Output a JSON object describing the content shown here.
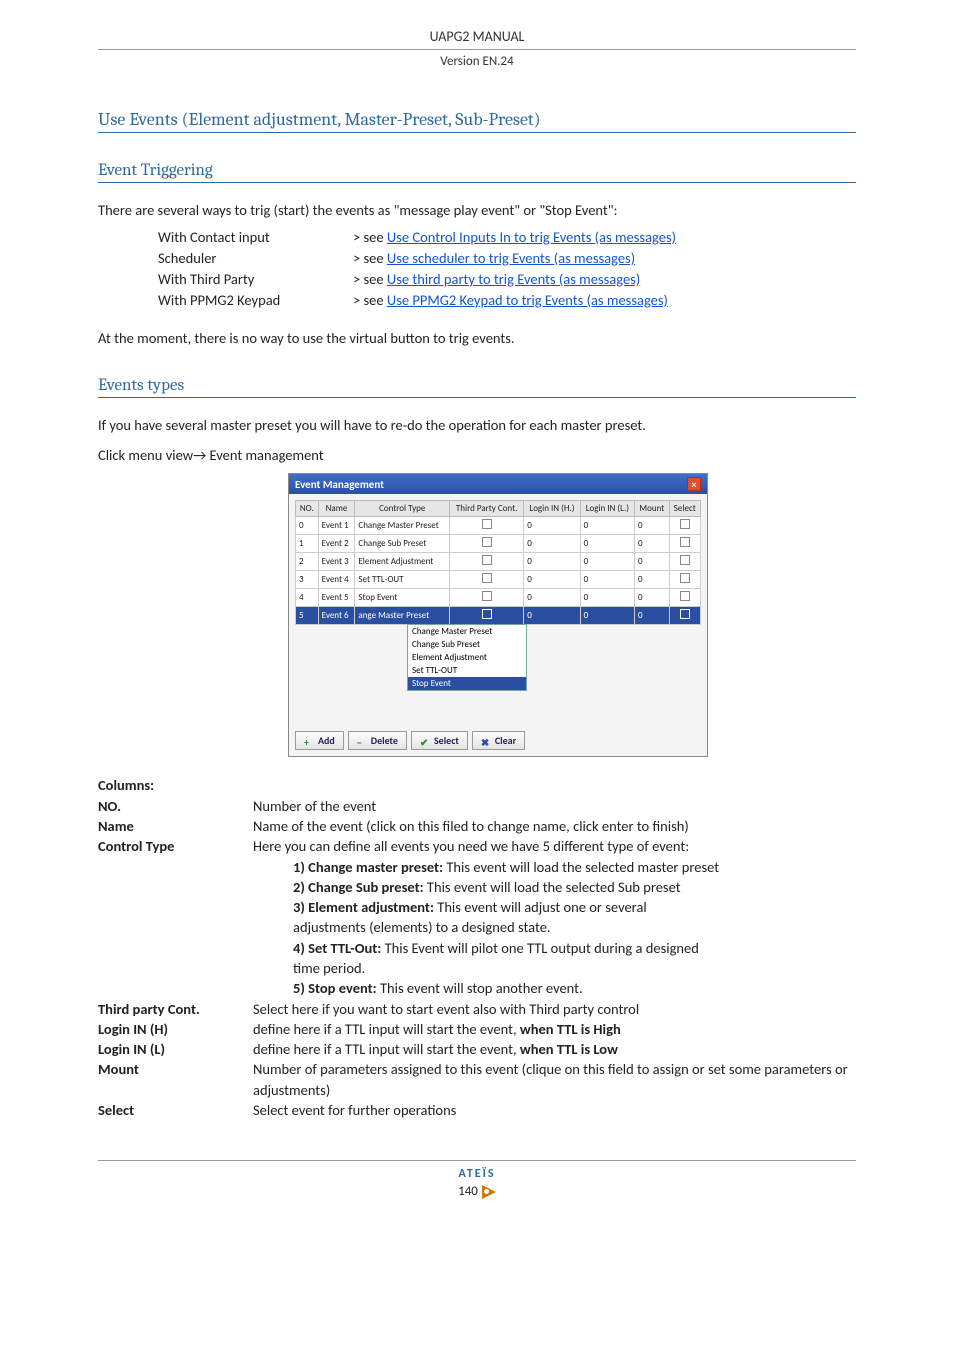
{
  "header": {
    "title": "UAPG2  MANUAL",
    "version": "Version EN.24"
  },
  "section1": {
    "title": "Use Events (Element adjustment, Master-Preset, Sub-Preset)"
  },
  "section2": {
    "title": "Event Triggering"
  },
  "intro": "There are several ways to trig (start) the events as \"message play event\" or \"Stop Event\":",
  "trig_rows": [
    {
      "label": "With Contact input",
      "prefix": "> see ",
      "link": "Use Control Inputs In to trig Events (as messages)"
    },
    {
      "label": "Scheduler",
      "prefix": "> see ",
      "link": "Use scheduler to trig Events (as messages)"
    },
    {
      "label": "With Third Party",
      "prefix": "> see ",
      "link": "Use third party to trig Events (as messages)"
    },
    {
      "label": "With PPMG2 Keypad",
      "prefix": "> see ",
      "link": "Use PPMG2 Keypad to trig Events (as messages)"
    }
  ],
  "note1": "At the moment, there is no way to use the virtual button to trig events.",
  "section3": {
    "title": "Events types"
  },
  "note2": "If you have several master preset you will have to re-do the operation for each master preset.",
  "note3": "Click menu view→ Event management",
  "em": {
    "title": "Event Management",
    "headers": [
      "NO.",
      "Name",
      "Control Type",
      "Third Party Cont.",
      "Login IN (H.)",
      "Login IN (L.)",
      "Mount",
      "Select"
    ],
    "rows": [
      {
        "no": "0",
        "name": "Event 1",
        "ct": "Change Master Preset",
        "tp": "",
        "lh": "0",
        "ll": "0",
        "m": "0"
      },
      {
        "no": "1",
        "name": "Event 2",
        "ct": "Change Sub Preset",
        "tp": "",
        "lh": "0",
        "ll": "0",
        "m": "0"
      },
      {
        "no": "2",
        "name": "Event 3",
        "ct": "Element Adjustment",
        "tp": "",
        "lh": "0",
        "ll": "0",
        "m": "0"
      },
      {
        "no": "3",
        "name": "Event 4",
        "ct": "Set TTL-OUT",
        "tp": "",
        "lh": "0",
        "ll": "0",
        "m": "0"
      },
      {
        "no": "4",
        "name": "Event 5",
        "ct": "Stop Event",
        "tp": "",
        "lh": "0",
        "ll": "0",
        "m": "0"
      },
      {
        "no": "5",
        "name": "Event 6",
        "ct": "ange Master Preset",
        "tp": "",
        "lh": "0",
        "ll": "0",
        "m": "0",
        "sel": true
      }
    ],
    "dropdown": [
      "Change Master Preset",
      "Change Sub Preset",
      "Element Adjustment",
      "Set TTL-OUT",
      "Stop Event"
    ],
    "buttons": {
      "add": "Add",
      "delete": "Delete",
      "select": "Select",
      "clear": "Clear"
    }
  },
  "cols": {
    "heading": "Columns:",
    "no_label": "NO.",
    "no_text": "Number of the event",
    "name_label": "Name",
    "name_text": "Name of the event (click on this filed to change name, click enter to finish)",
    "ct_label": "Control Type",
    "ct_text": "Here you can define all events you need we have 5 different type of event:",
    "ct_1b": "1) Change master preset:",
    "ct_1": " This event will load the selected master preset",
    "ct_2b": "2) Change Sub preset:",
    "ct_2": " This event will load the selected Sub preset",
    "ct_3b": "3) Element adjustment:",
    "ct_3": " This event will adjust one or several",
    "ct_3c": "adjustments (elements) to a designed state.",
    "ct_4b": "4) Set TTL-Out:",
    "ct_4": " This Event will pilot one TTL output during a designed",
    "ct_4c": "time period.",
    "ct_5b": "5) Stop event:",
    "ct_5": " This event will stop another event.",
    "tp_label": "Third party Cont.",
    "tp_text": "Select here if you want to start event also with Third party control",
    "lh_label": "Login IN (H)",
    "lh_text_a": "define here if a TTL input will start the event, ",
    "lh_text_b": "when TTL is High",
    "ll_label": "Login IN (L)",
    "ll_text_a": "define here if a TTL input will start the event, ",
    "ll_text_b": "when TTL is Low",
    "m_label": "Mount",
    "m_text": "Number of parameters assigned to this event (clique on this field to assign or set some parameters or adjustments)",
    "s_label": "Select",
    "s_text": "Select event for further operations"
  },
  "footer": {
    "logo": "ATEÏS",
    "page": "140"
  }
}
